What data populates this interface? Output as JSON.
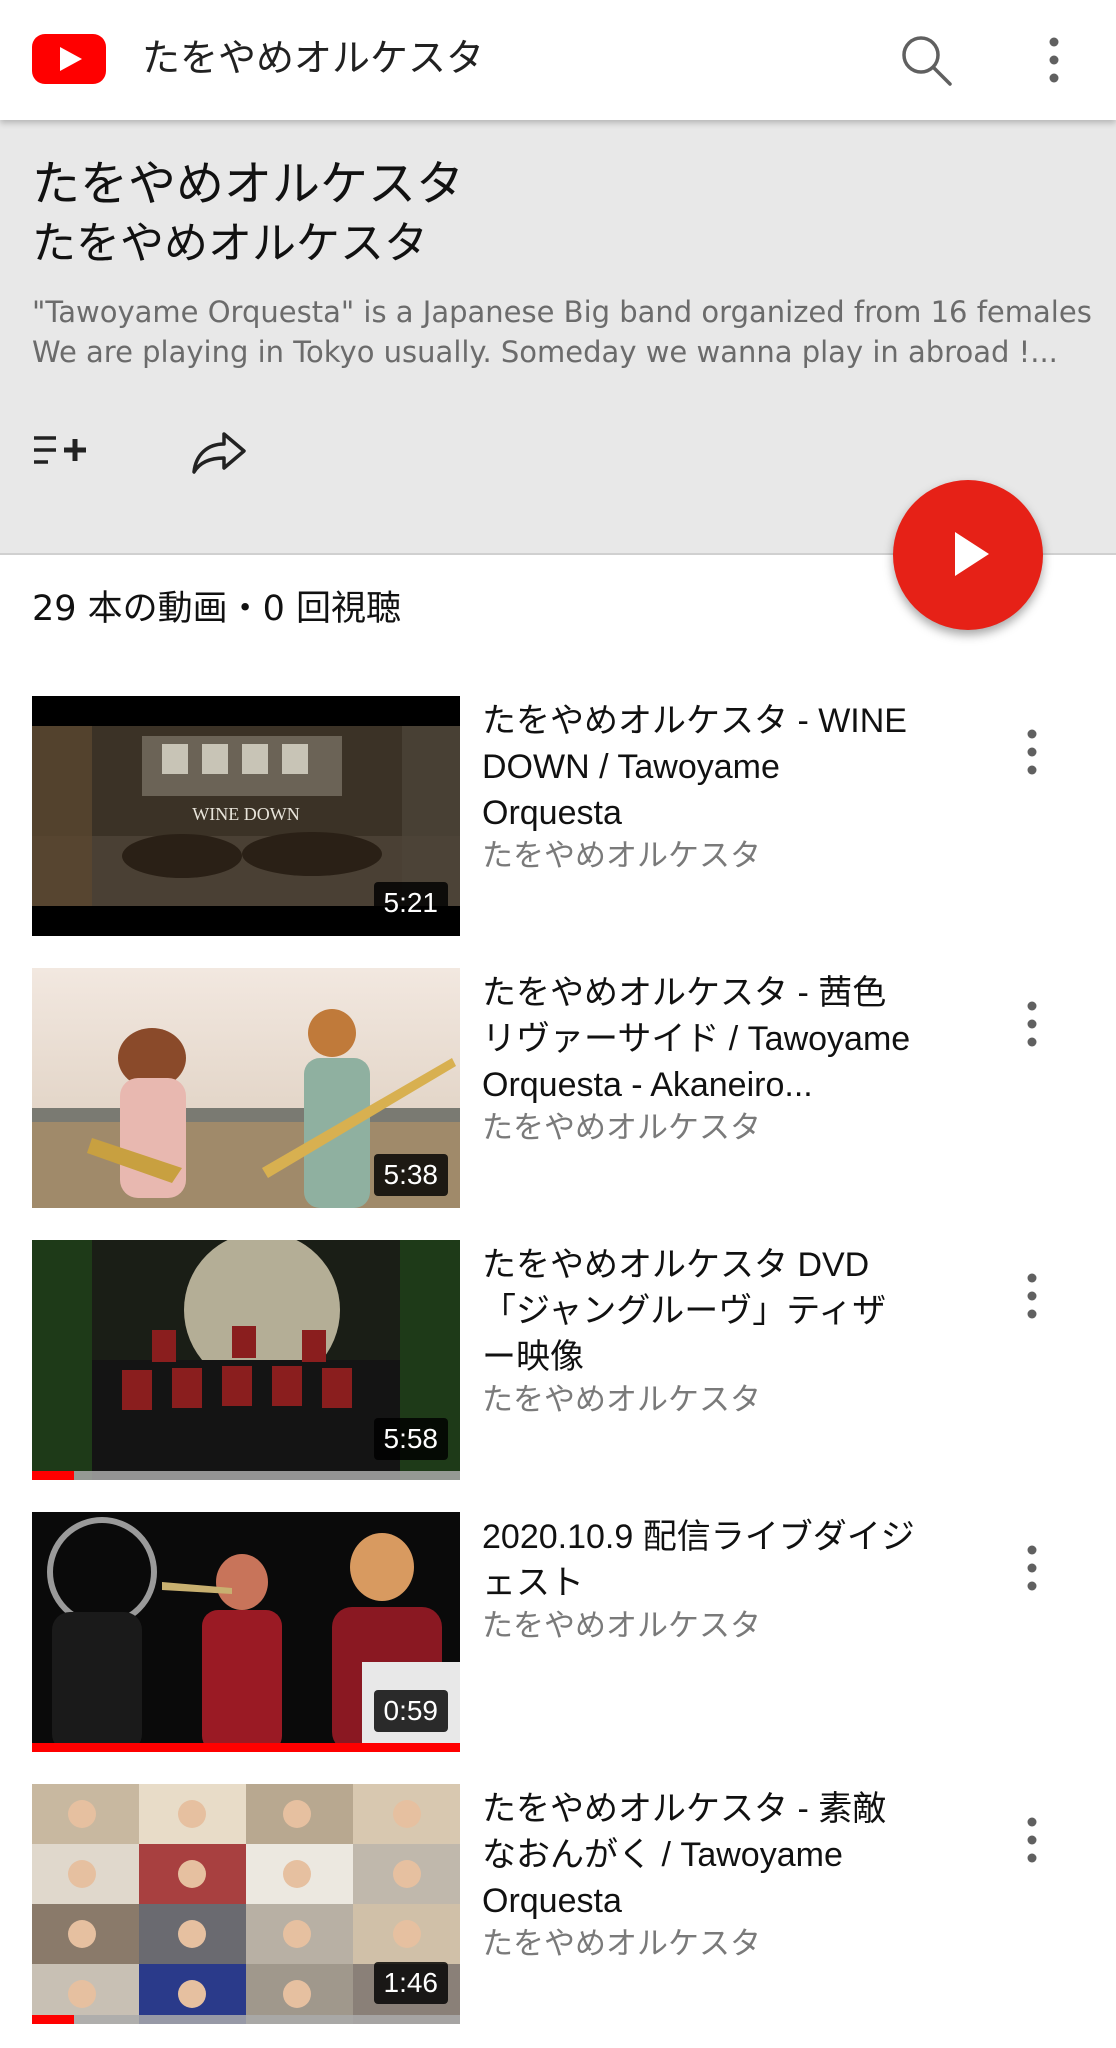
{
  "app": {
    "title": "たをやめオルケスタ",
    "icons": {
      "logo": "youtube-logo",
      "search": "search-icon",
      "more": "more-vert-icon"
    }
  },
  "playlist": {
    "title": "たをやめオルケスタ",
    "owner": "たをやめオルケスタ",
    "description_lines": [
      "\"Tawoyame Orquesta\" is a Japanese Big band organized from 16 females.",
      "We are playing in Tokyo usually. Someday we wanna play in abroad !..."
    ],
    "stats": "29 本の動画・0 回視聴"
  },
  "videos": [
    {
      "title_lines": [
        "たをやめオルケスタ - WINE",
        "DOWN / Tawoyame",
        "Orquesta"
      ],
      "channel": "たをやめオルケスタ",
      "duration": "5:21",
      "overlay_text": "WINE DOWN",
      "progress": 0
    },
    {
      "title_lines": [
        "たをやめオルケスタ - 茜色",
        "リヴァーサイド / Tawoyame",
        "Orquesta - Akaneiro..."
      ],
      "channel": "たをやめオルケスタ",
      "duration": "5:38",
      "progress": 0
    },
    {
      "title_lines": [
        "たをやめオルケスタ DVD",
        "「ジャングルーヴ」ティザ",
        "ー映像"
      ],
      "channel": "たをやめオルケスタ",
      "duration": "5:58",
      "progress": 0.1
    },
    {
      "title_lines": [
        "2020.10.9 配信ライブダイジ",
        "ェスト"
      ],
      "channel": "たをやめオルケスタ",
      "duration": "0:59",
      "progress": 1.0
    },
    {
      "title_lines": [
        "たをやめオルケスタ - 素敵",
        "なおんがく / Tawoyame",
        "Orquesta"
      ],
      "channel": "たをやめオルケスタ",
      "duration": "1:46",
      "progress": 0.1
    }
  ],
  "colors": {
    "accent": "#ff0000",
    "fab": "#e62117",
    "header_bg": "#e8e8e8"
  }
}
